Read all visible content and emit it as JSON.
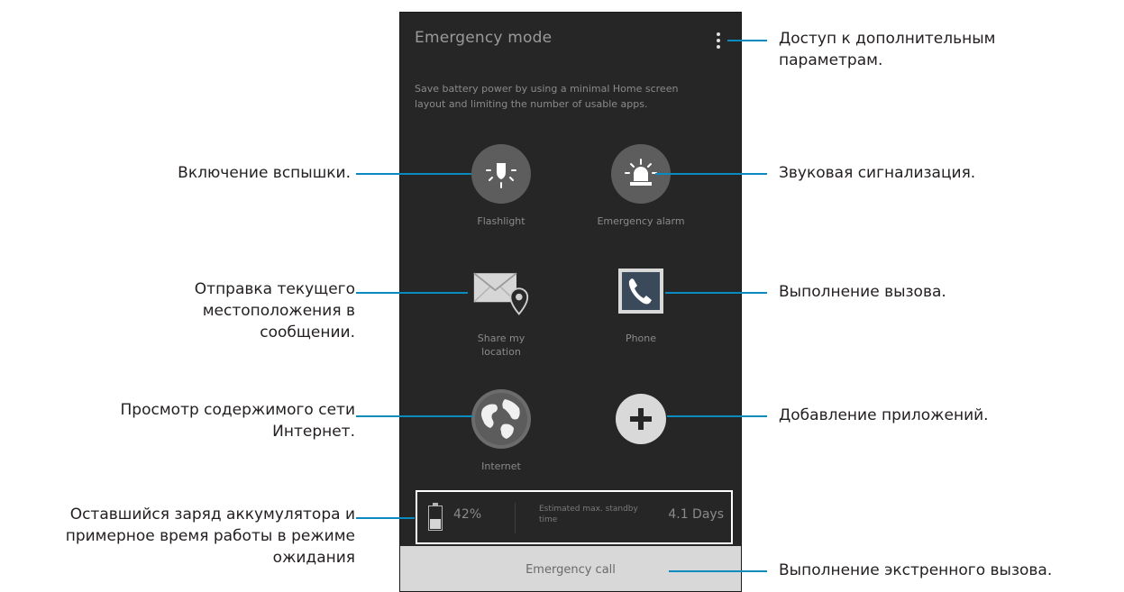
{
  "phone": {
    "title": "Emergency mode",
    "description": "Save battery power by using a minimal Home screen layout and limiting the number of usable apps.",
    "apps": [
      {
        "label": "Flashlight",
        "icon": "flashlight-icon"
      },
      {
        "label": "Emergency alarm",
        "icon": "alarm-icon"
      },
      {
        "label": "Share my location",
        "icon": "envelope-location-icon"
      },
      {
        "label": "Phone",
        "icon": "phone-icon"
      },
      {
        "label": "Internet",
        "icon": "globe-icon"
      },
      {
        "label": "",
        "icon": "plus-icon"
      }
    ],
    "battery": {
      "percent_text": "42%",
      "level": 0.42
    },
    "estimated_label": "Estimated max. standby time",
    "estimated_value": "4.1 Days",
    "emergency_call": "Emergency call"
  },
  "callouts": {
    "more_options": "Доступ к дополнительным параметрам.",
    "flashlight": "Включение вспышки.",
    "alarm": "Звуковая сигнализация.",
    "share_location": "Отправка текущего местоположения в сообщении.",
    "phone": "Выполнение вызова.",
    "internet": "Просмотр содержимого сети Интернет.",
    "add_apps": "Добавление приложений.",
    "battery": "Оставшийся заряд аккумулятора и примерное время работы в режиме ожидания",
    "emergency_call": "Выполнение экстренного вызова."
  },
  "colors": {
    "callout_line": "#0a8bc0",
    "phone_bg": "#262626"
  }
}
